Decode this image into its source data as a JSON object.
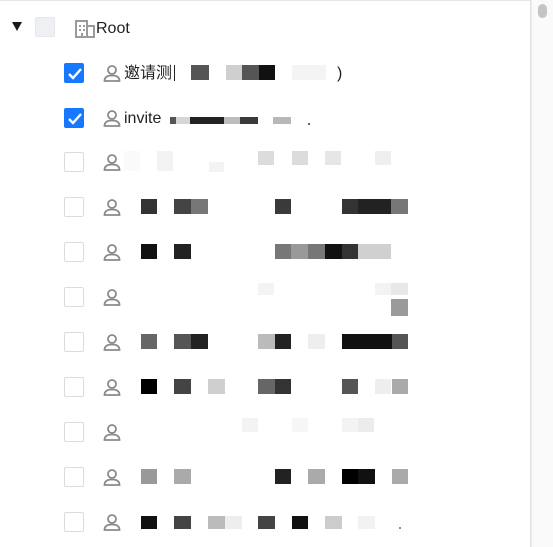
{
  "tree": {
    "root": {
      "label": "Root",
      "checked": false,
      "expanded": true
    },
    "children": [
      {
        "label": "邀请测",
        "suffix": ")",
        "checked": true
      },
      {
        "label": "invite",
        "suffix": "",
        "checked": true
      },
      {
        "label": "",
        "suffix": "",
        "checked": false
      },
      {
        "label": "",
        "suffix": "",
        "checked": false
      },
      {
        "label": "",
        "suffix": "",
        "checked": false
      },
      {
        "label": "",
        "suffix": "",
        "checked": false
      },
      {
        "label": "",
        "suffix": "",
        "checked": false
      },
      {
        "label": "",
        "suffix": "",
        "checked": false
      },
      {
        "label": "",
        "suffix": "",
        "checked": false
      },
      {
        "label": "",
        "suffix": "",
        "checked": false
      },
      {
        "label": "",
        "suffix": "",
        "checked": false
      }
    ]
  },
  "colors": {
    "accent": "#1677ff",
    "icon": "#8a8a8a",
    "text": "#1f1f1f"
  },
  "icons": {
    "expand": "caret-down-icon",
    "root": "building-icon",
    "child": "user-icon"
  }
}
